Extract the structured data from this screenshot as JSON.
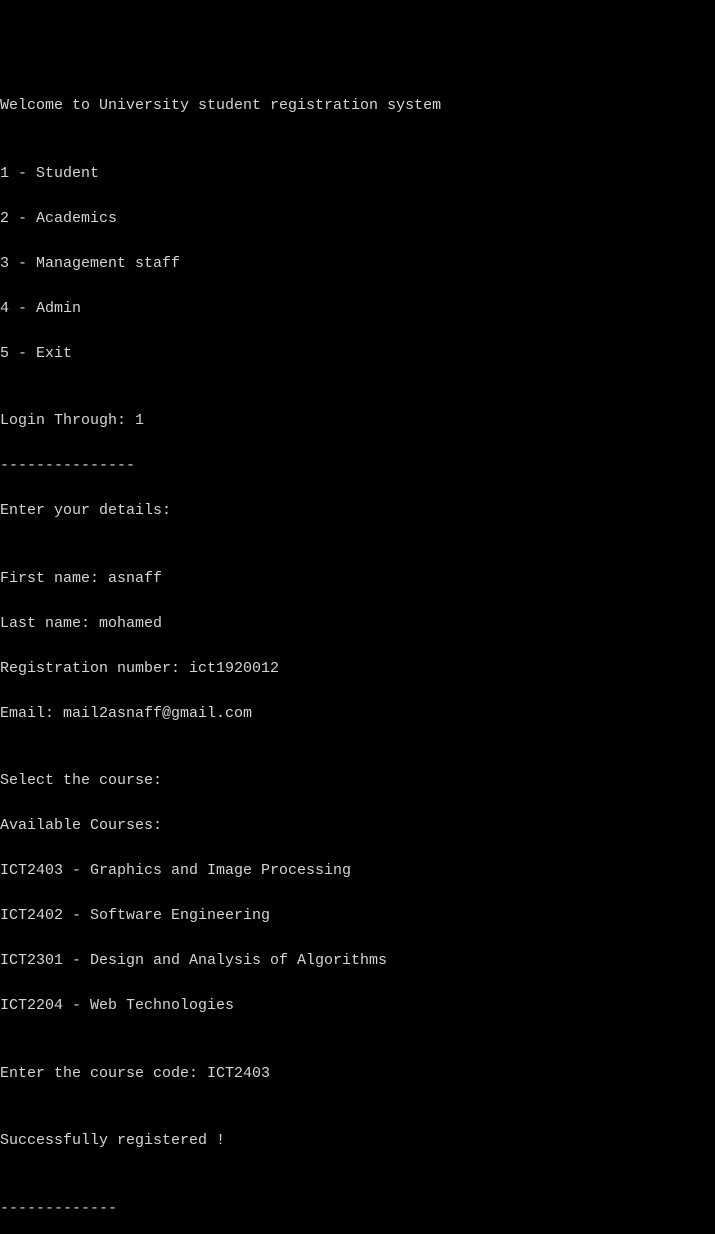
{
  "welcome": "Welcome to University student registration system",
  "blank": "",
  "menu": {
    "item1": "1 - Student",
    "item2": "2 - Academics",
    "item3": "3 - Management staff",
    "item4": "4 - Admin",
    "item5": "5 - Exit"
  },
  "login": {
    "prompt": "Login Through: ",
    "value": "1",
    "divider": "---------------",
    "details_header": "Enter your details:"
  },
  "details": {
    "first_name_label": "First name: ",
    "first_name_value": "asnaff",
    "last_name_label": "Last name: ",
    "last_name_value": "mohamed",
    "reg_label": "Registration number: ",
    "reg_value": "ict1920012",
    "email_label": "Email: ",
    "email_value": "mail2asnaff@gmail.com"
  },
  "courses": {
    "select_header": "Select the course:",
    "available_header": "Available Courses:",
    "course1": "ICT2403 - Graphics and Image Processing",
    "course2": "ICT2402 - Software Engineering",
    "course3": "ICT2301 - Design and Analysis of Algorithms",
    "course4": "ICT2204 - Web Technologies"
  },
  "enter_code": {
    "prompt": "Enter the course code: ",
    "value": "ICT2403"
  },
  "success": "Successfully registered !",
  "footer_divider": "-------------"
}
